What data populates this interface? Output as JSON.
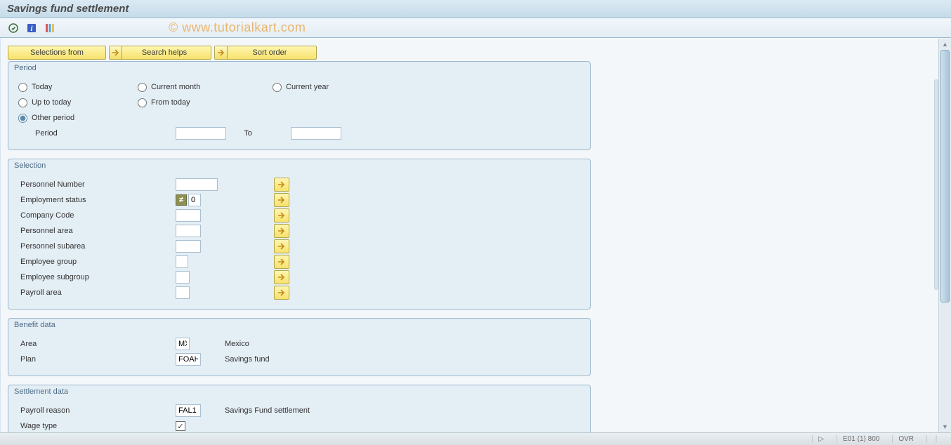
{
  "header": {
    "title": "Savings fund settlement"
  },
  "watermark": "© www.tutorialkart.com",
  "action_buttons": {
    "selections_from": "Selections from",
    "search_helps": "Search helps",
    "sort_order": "Sort order"
  },
  "period_group": {
    "title": "Period",
    "options": {
      "today": "Today",
      "current_month": "Current month",
      "current_year": "Current year",
      "up_to_today": "Up to today",
      "from_today": "From today",
      "other_period": "Other period"
    },
    "period_label": "Period",
    "to_label": "To",
    "period_from_value": "",
    "period_to_value": ""
  },
  "selection_group": {
    "title": "Selection",
    "rows": {
      "pernr": {
        "label": "Personnel Number",
        "value": ""
      },
      "emp_status": {
        "label": "Employment status",
        "value": "0",
        "neq": true
      },
      "company_code": {
        "label": "Company Code",
        "value": ""
      },
      "pers_area": {
        "label": "Personnel area",
        "value": ""
      },
      "pers_subarea": {
        "label": "Personnel subarea",
        "value": ""
      },
      "emp_group": {
        "label": "Employee group",
        "value": ""
      },
      "emp_subgroup": {
        "label": "Employee subgroup",
        "value": ""
      },
      "payroll_area": {
        "label": "Payroll area",
        "value": ""
      }
    }
  },
  "benefit_group": {
    "title": "Benefit data",
    "area": {
      "label": "Area",
      "value": "MX",
      "desc": "Mexico"
    },
    "plan": {
      "label": "Plan",
      "value": "FOAH",
      "desc": "Savings fund"
    }
  },
  "settlement_group": {
    "title": "Settlement data",
    "payroll_reason": {
      "label": "Payroll reason",
      "value": "FAL1",
      "desc": "Savings Fund settlement"
    },
    "wage_type": {
      "label": "Wage type",
      "checked": "✓"
    }
  },
  "status": {
    "system": "E01 (1) 800",
    "ovr": "OVR"
  }
}
